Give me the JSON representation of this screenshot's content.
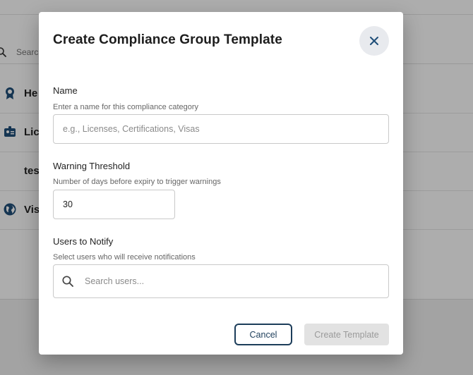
{
  "background": {
    "search_placeholder": "Search",
    "rows": [
      {
        "label": "He",
        "icon": "award-icon"
      },
      {
        "label": "Lic",
        "icon": "id-badge-icon"
      },
      {
        "label": "tes",
        "icon": ""
      },
      {
        "label": "Vis",
        "icon": "globe-icon"
      }
    ]
  },
  "dialog": {
    "title": "Create Compliance Group Template",
    "close_icon": "close-icon",
    "name": {
      "label": "Name",
      "help": "Enter a name for this compliance category",
      "placeholder": "e.g., Licenses, Certifications, Visas",
      "value": ""
    },
    "warning_threshold": {
      "label": "Warning Threshold",
      "help": "Number of days before expiry to trigger warnings",
      "value": "30"
    },
    "users_to_notify": {
      "label": "Users to Notify",
      "help": "Select users who will receive notifications",
      "placeholder": "Search users...",
      "icon": "search-icon"
    },
    "buttons": {
      "cancel": "Cancel",
      "create": "Create Template",
      "create_disabled": true
    }
  },
  "colors": {
    "accent": "#1c3d5a",
    "icon_blue": "#1f4e79",
    "overlay": "rgba(0,0,0,0.32)",
    "disabled_bg": "#e2e2e2"
  }
}
